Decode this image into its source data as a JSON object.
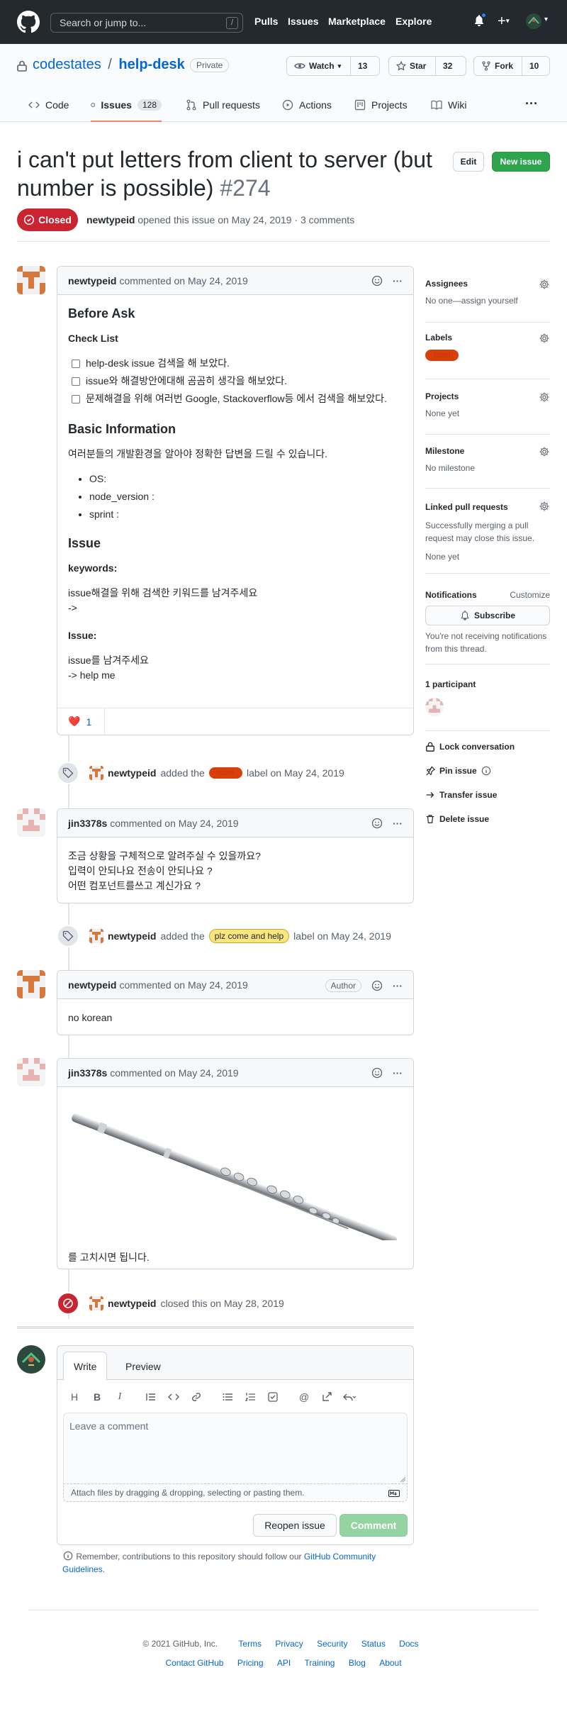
{
  "header": {
    "search_placeholder": "Search or jump to...",
    "slash": "/",
    "nav": [
      "Pulls",
      "Issues",
      "Marketplace",
      "Explore"
    ],
    "plus": "+",
    "caret": "▾"
  },
  "repo": {
    "owner": "codestates",
    "sep": "/",
    "name": "help-desk",
    "visibility": "Private",
    "watch": {
      "label": "Watch",
      "count": "13"
    },
    "star": {
      "label": "Star",
      "count": "32"
    },
    "fork": {
      "label": "Fork",
      "count": "10"
    },
    "tabs": [
      {
        "label": "Code"
      },
      {
        "label": "Issues",
        "count": "128"
      },
      {
        "label": "Pull requests"
      },
      {
        "label": "Actions"
      },
      {
        "label": "Projects"
      },
      {
        "label": "Wiki"
      }
    ],
    "more": "···"
  },
  "issue": {
    "title": "i can't put letters from client to server (but number is possible)",
    "number": "#274",
    "edit": "Edit",
    "new_issue": "New issue",
    "state": "Closed",
    "author": "newtypeid",
    "meta": "opened this issue on May 24, 2019 · 3 comments"
  },
  "comment1": {
    "author": "newtypeid",
    "when": "commented on May 24, 2019",
    "h_before": "Before Ask",
    "h_check": "Check List",
    "checks": [
      "help-desk issue 검색을 해 보았다.",
      "issue와 해결방안에대해 곰곰히 생각을 해보았다.",
      "문제해결을 위해 여러번 Google, Stackoverflow등 에서 검색을 해보았다."
    ],
    "h_basic": "Basic Information",
    "basic_p": "여러분들의 개발환경을 알아야 정확한 답변을 드릴 수 있습니다.",
    "basic_items": [
      "OS:",
      "node_version :",
      "sprint :"
    ],
    "h_issue": "Issue",
    "h_keywords": "keywords:",
    "kw1": "issue해결을 위해 검색한 키워드를 남겨주세요",
    "kw2": "->",
    "h_issue2": "Issue:",
    "is1": "issue를 남겨주세요",
    "is2": "-> help me",
    "reaction_emoji": "❤️",
    "reaction_count": "1"
  },
  "event1": {
    "user": "newtypeid",
    "before": "added the",
    "label": "label",
    "after": "label on May 24, 2019",
    "label_color": "#d93f0b"
  },
  "comment2": {
    "author": "jin3378s",
    "when": "commented on May 24, 2019",
    "lines": [
      "조금 상황을 구체적으로 알려주실 수 있을까요?",
      "입력이 안되나요 전송이 안되나요 ?",
      "어떤 컴포넌트를쓰고 계신가요 ?"
    ]
  },
  "event2": {
    "user": "newtypeid",
    "before": "added the",
    "label": "plz come and help",
    "after": "label on May 24, 2019",
    "label_color": "#fbe57f"
  },
  "comment3": {
    "author": "newtypeid",
    "when": "commented on May 24, 2019",
    "badge": "Author",
    "body": "no korean"
  },
  "comment4": {
    "author": "jin3378s",
    "when": "commented on May 24, 2019",
    "body": "를 고치시면 됩니다."
  },
  "event3": {
    "user": "newtypeid",
    "text": "closed this on May 28, 2019"
  },
  "sidebar": {
    "assignees": {
      "title": "Assignees",
      "value": "No one—assign yourself"
    },
    "labels": {
      "title": "Labels",
      "value": "label"
    },
    "projects": {
      "title": "Projects",
      "value": "None yet"
    },
    "milestone": {
      "title": "Milestone",
      "value": "No milestone"
    },
    "linked": {
      "title": "Linked pull requests",
      "desc": "Successfully merging a pull request may close this issue.",
      "value": "None yet"
    },
    "notifications": {
      "title": "Notifications",
      "customize": "Customize",
      "subscribe": "Subscribe",
      "desc": "You're not receiving notifications from this thread."
    },
    "participants": {
      "title": "1 participant"
    },
    "actions": [
      "Lock conversation",
      "Pin issue",
      "Transfer issue",
      "Delete issue"
    ]
  },
  "editor": {
    "write": "Write",
    "preview": "Preview",
    "placeholder": "Leave a comment",
    "attach": "Attach files by dragging & dropping, selecting or pasting them.",
    "reopen": "Reopen issue",
    "comment": "Comment",
    "note": "Remember, contributions to this repository should follow our",
    "note_link": "GitHub Community Guidelines",
    "note_end": "."
  },
  "footer": {
    "copyright": "© 2021 GitHub, Inc.",
    "row1": [
      "Terms",
      "Privacy",
      "Security",
      "Status",
      "Docs"
    ],
    "row2": [
      "Contact GitHub",
      "Pricing",
      "API",
      "Training",
      "Blog",
      "About"
    ]
  },
  "colors": {
    "accent": "#0366d6",
    "green": "#2ea44f",
    "closed": "#cb2431",
    "header": "#24292e"
  }
}
